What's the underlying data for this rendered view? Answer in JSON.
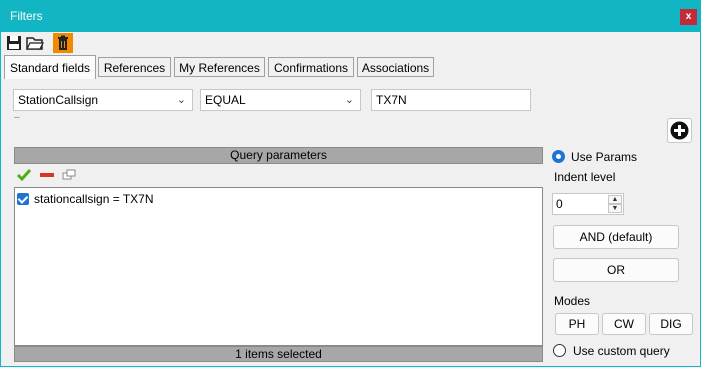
{
  "window": {
    "title": "Filters",
    "close_label": "x"
  },
  "toolbar": {
    "icons": [
      "save-icon",
      "open-folder-icon",
      "trash-icon"
    ]
  },
  "tabs": [
    "Standard fields",
    "References",
    "My References",
    "Confirmations",
    "Associations"
  ],
  "filter_row": {
    "field": "StationCallsign",
    "operator": "EQUAL",
    "value": "TX7N",
    "dash": "–"
  },
  "query": {
    "header": "Query parameters",
    "items": [
      {
        "checked": true,
        "text": "stationcallsign = TX7N"
      }
    ],
    "status": "1 items selected"
  },
  "right_panel": {
    "use_params_label": "Use Params",
    "indent_label": "Indent level",
    "indent_value": "0",
    "and_label": "AND (default)",
    "or_label": "OR",
    "modes_label": "Modes",
    "modes": [
      "PH",
      "CW",
      "DIG"
    ],
    "custom_query_label": "Use custom query"
  },
  "colors": {
    "titlebar": "#12b5c4",
    "close": "#c42b3a",
    "accent": "#1f74d3",
    "delete_tool": "#f08a00"
  }
}
